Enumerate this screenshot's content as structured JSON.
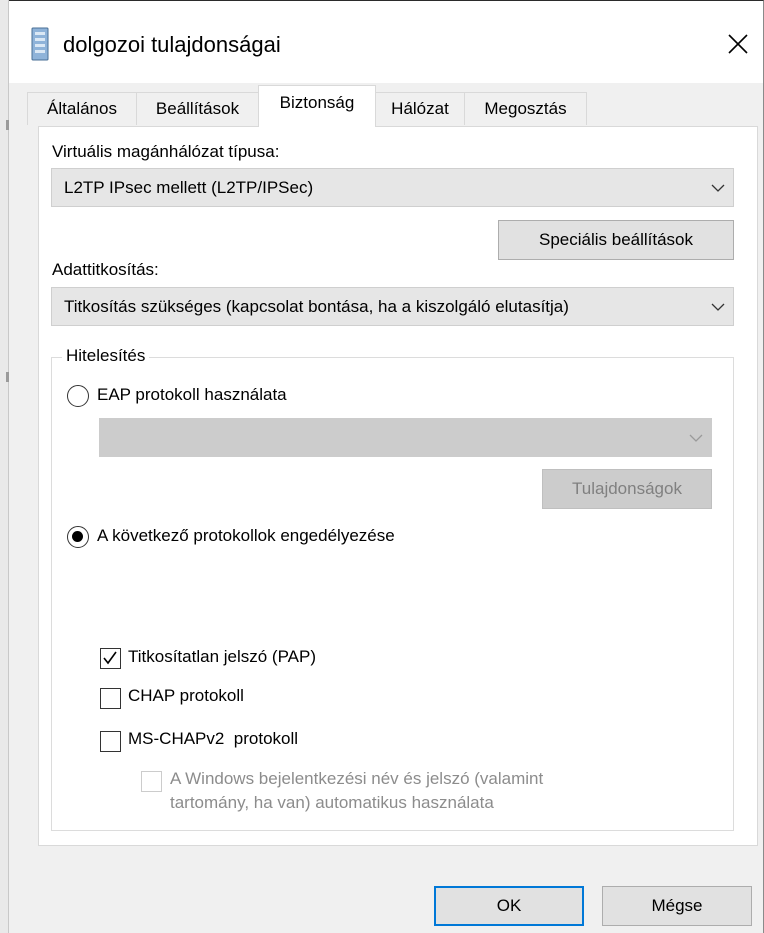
{
  "window": {
    "title": "dolgozoi tulajdonságai",
    "icon": "network-connection-icon",
    "close_icon": "close-icon"
  },
  "tabs": [
    {
      "label": "Általános",
      "active": false
    },
    {
      "label": "Beállítások",
      "active": false
    },
    {
      "label": "Biztonság",
      "active": true
    },
    {
      "label": "Hálózat",
      "active": false
    },
    {
      "label": "Megosztás",
      "active": false
    }
  ],
  "vpn": {
    "label": "Virtuális magánhálózat típusa:",
    "selected": "L2TP IPsec mellett (L2TP/IPSec)",
    "advanced_button": "Speciális beállítások"
  },
  "encryption": {
    "label": "Adattitkosítás:",
    "selected": "Titkosítás szükséges (kapcsolat bontása, ha a kiszolgáló elutasítja)"
  },
  "auth": {
    "group_title": "Hitelesítés",
    "eap_label": "EAP protokoll használata",
    "eap_checked": false,
    "eap_combo_value": "",
    "properties_button": "Tulajdonságok",
    "allow_label": "A következő protokollok engedélyezése",
    "allow_checked": true,
    "pap_label": "Titkosítatlan jelszó (PAP)",
    "pap_checked": true,
    "chap_label": "CHAP protokoll",
    "chap_checked": false,
    "mschap_label": "MS-CHAPv2  protokoll",
    "mschap_checked": false,
    "windows_logon_line1": "A Windows bejelentkezési név és jelszó (valamint",
    "windows_logon_line2": "tartomány, ha van) automatikus használata",
    "windows_logon_checked": false
  },
  "footer": {
    "ok": "OK",
    "cancel": "Mégse"
  },
  "colors": {
    "accent": "#0078d7",
    "dialog_bg": "#f0f0f0",
    "disabled_bg": "#cccccc",
    "disabled_text": "#8c8c8c"
  }
}
